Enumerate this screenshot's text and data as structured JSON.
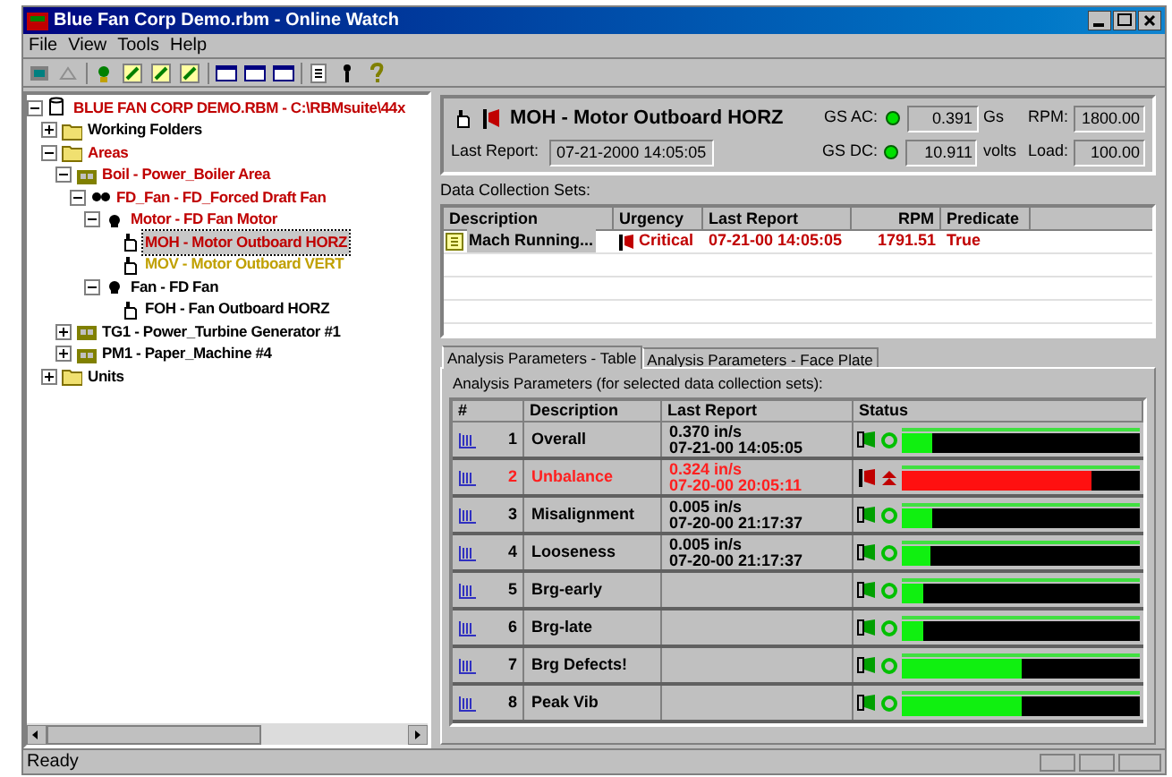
{
  "window": {
    "title": "Blue Fan Corp Demo.rbm - Online Watch"
  },
  "menu": [
    {
      "label": "File"
    },
    {
      "label": "View"
    },
    {
      "label": "Tools"
    },
    {
      "label": "Help"
    }
  ],
  "tree": [
    {
      "label": "BLUE FAN CORP DEMO.RBM - C:\\RBMsuite\\44x",
      "kind": "database",
      "color": "#c00000",
      "expanded": true,
      "selected": false,
      "children": [
        {
          "label": "Working Folders",
          "kind": "folder",
          "color": "#000000",
          "expanded": false,
          "selected": false
        },
        {
          "label": "Areas",
          "kind": "folder",
          "color": "#c00000",
          "expanded": true,
          "selected": false,
          "children": [
            {
              "label": "Boil - Power_Boiler Area",
              "kind": "area",
              "color": "#c00000",
              "expanded": true,
              "selected": false,
              "children": [
                {
                  "label": "FD_Fan - FD_Forced Draft Fan",
                  "kind": "machine",
                  "color": "#c00000",
                  "expanded": true,
                  "selected": false,
                  "children": [
                    {
                      "label": "Motor - FD Fan Motor",
                      "kind": "component",
                      "color": "#c00000",
                      "expanded": true,
                      "selected": false,
                      "children": [
                        {
                          "label": "MOH - Motor Outboard HORZ",
                          "kind": "point",
                          "color": "#c00000",
                          "selected": true
                        },
                        {
                          "label": "MOV - Motor Outboard VERT",
                          "kind": "point",
                          "color": "#c0a000",
                          "selected": false
                        }
                      ]
                    },
                    {
                      "label": "Fan - FD Fan",
                      "kind": "component",
                      "color": "#000000",
                      "expanded": true,
                      "selected": false,
                      "children": [
                        {
                          "label": "FOH - Fan Outboard HORZ",
                          "kind": "point",
                          "color": "#000000",
                          "selected": false
                        }
                      ]
                    }
                  ]
                }
              ]
            },
            {
              "label": "TG1 - Power_Turbine Generator #1",
              "kind": "area",
              "color": "#000000",
              "expanded": false,
              "selected": false
            },
            {
              "label": "PM1 - Paper_Machine #4",
              "kind": "area",
              "color": "#000000",
              "expanded": false,
              "selected": false
            }
          ]
        },
        {
          "label": "Units",
          "kind": "folder",
          "color": "#000000",
          "expanded": false,
          "selected": false
        }
      ]
    }
  ],
  "point": {
    "name": "MOH - Motor Outboard HORZ",
    "last_report_label": "Last Report:",
    "last_report": "07-21-2000 14:05:05",
    "gs_ac": {
      "label": "GS AC:",
      "value": "0.391",
      "unit": "Gs"
    },
    "gs_dc": {
      "label": "GS DC:",
      "value": "10.911",
      "unit": "volts"
    },
    "rpm": {
      "label": "RPM:",
      "value": "1800.00"
    },
    "load": {
      "label": "Load:",
      "value": "100.00"
    }
  },
  "data_collection": {
    "label": "Data Collection Sets:",
    "columns": [
      "Description",
      "Urgency",
      "Last Report",
      "RPM",
      "Predicate"
    ],
    "rows": [
      {
        "description": "Mach Running...",
        "urgency": "Critical",
        "last_report": "07-21-00 14:05:05",
        "rpm": "1791.51",
        "predicate": "True",
        "alarm": true
      }
    ]
  },
  "tabs": [
    {
      "label": "Analysis Parameters - Table",
      "selected": true
    },
    {
      "label": "Analysis Parameters - Face Plate",
      "selected": false
    }
  ],
  "analysis": {
    "caption": "Analysis Parameters (for selected data collection sets):",
    "columns": [
      "#",
      "Description",
      "Last Report",
      "Status"
    ],
    "rows": [
      {
        "number": "1",
        "description": "Overall",
        "value": "0.370 in/s",
        "time": "07-21-00 14:05:05",
        "alarm": false,
        "level": 0.13
      },
      {
        "number": "2",
        "description": "Unbalance",
        "value": "0.324 in/s",
        "time": "07-20-00 20:05:11",
        "alarm": true,
        "level": 0.8
      },
      {
        "number": "3",
        "description": "Misalignment",
        "value": "0.005 in/s",
        "time": "07-20-00 21:17:37",
        "alarm": false,
        "level": 0.13
      },
      {
        "number": "4",
        "description": "Looseness",
        "value": "0.005 in/s",
        "time": "07-20-00 21:17:37",
        "alarm": false,
        "level": 0.12
      },
      {
        "number": "5",
        "description": "Brg-early",
        "alarm": false,
        "level": 0.09
      },
      {
        "number": "6",
        "description": "Brg-late",
        "alarm": false,
        "level": 0.09
      },
      {
        "number": "7",
        "description": "Brg Defects!",
        "alarm": false,
        "level": 0.5
      },
      {
        "number": "8",
        "description": "Peak Vib",
        "alarm": false,
        "level": 0.5
      }
    ]
  },
  "status_bar": "Ready"
}
